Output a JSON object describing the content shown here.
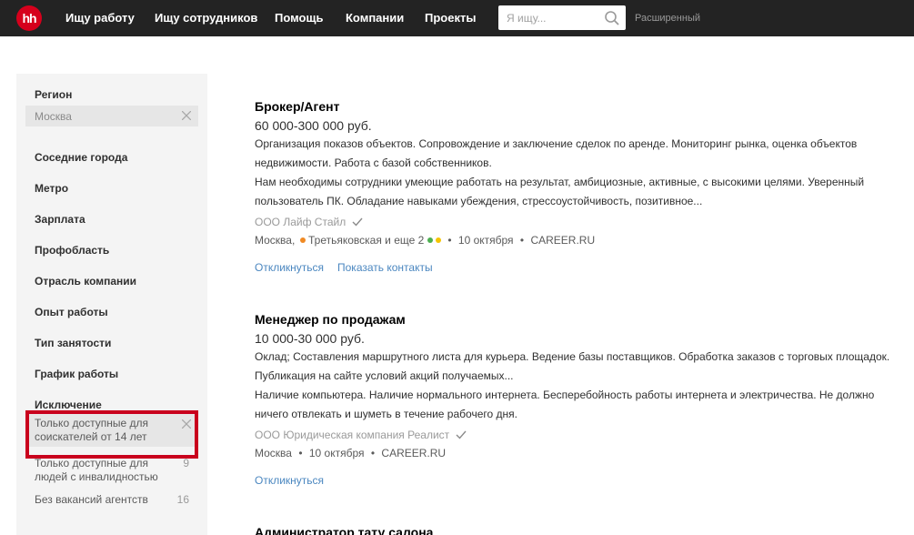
{
  "header": {
    "logo_text": "hh",
    "nav": [
      "Ищу работу",
      "Ищу сотрудников",
      "Помощь",
      "Компании",
      "Проекты"
    ],
    "search_placeholder": "Я ищу...",
    "search_icon": "search-icon",
    "advanced_label": "Расширенный"
  },
  "sidebar": {
    "region_title": "Регион",
    "region_value": "Москва",
    "filters": [
      "Соседние города",
      "Метро",
      "Зарплата",
      "Профобласть",
      "Отрасль компании",
      "Опыт работы",
      "Тип занятости",
      "График работы"
    ],
    "exclusion_title": "Исключение",
    "exclusions": [
      {
        "label": "Только доступные для соискателей от 14 лет",
        "count": "",
        "selected": true
      },
      {
        "label": "Только доступные для людей с инвалидностью",
        "count": "9"
      },
      {
        "label": "Без вакансий агентств",
        "count": "16"
      }
    ]
  },
  "vacancies": [
    {
      "title": "Брокер/Агент",
      "salary": "60 000-300 000 руб.",
      "responsibility": [
        "Организация показов объектов. Сопровождение и заключение сделок по аренде. Мониторинг рынка, оценка объектов",
        "недвижимости. Работа с базой собственников."
      ],
      "requirement": [
        "Нам необходимы сотрудники умеющие работать на результат, амбициозные, активные, с высокими целями. Уверенный",
        "пользователь ПК. Обладание навыками убеждения, стрессоустойчивость, позитивное..."
      ],
      "company": "ООО Лайф Стайл",
      "city": "Москва,",
      "metro": "Третьяковская и еще 2",
      "date": "10 октября",
      "source": "CAREER.RU",
      "respond_label": "Откликнуться",
      "contacts_label": "Показать контакты"
    },
    {
      "title": "Менеджер по продажам",
      "salary": "10 000-30 000 руб.",
      "responsibility": [
        "Оклад; Составления маршрутного листа для курьера. Ведение базы поставщиков. Обработка заказов с торговых площадок.",
        "Публикация на сайте условий акций получаемых..."
      ],
      "requirement": [
        "Наличие компьютера. Наличие нормального интернета. Бесперебойность работы интернета и электричества. Не должно",
        "ничего отвлекать и шуметь в течение рабочего дня."
      ],
      "company": "ООО Юридическая компания Реалист",
      "city": "Москва",
      "date": "10 октября",
      "source": "CAREER.RU",
      "respond_label": "Откликнуться"
    },
    {
      "title": "Администратор тату салона"
    }
  ],
  "colors": {
    "brand_red": "#d6001c",
    "link_blue": "#4b87c0",
    "metro_orange": "#f08a24",
    "metro_green": "#4caf50",
    "metro_yellow": "#f5c400",
    "highlight_red": "#c9001d"
  }
}
